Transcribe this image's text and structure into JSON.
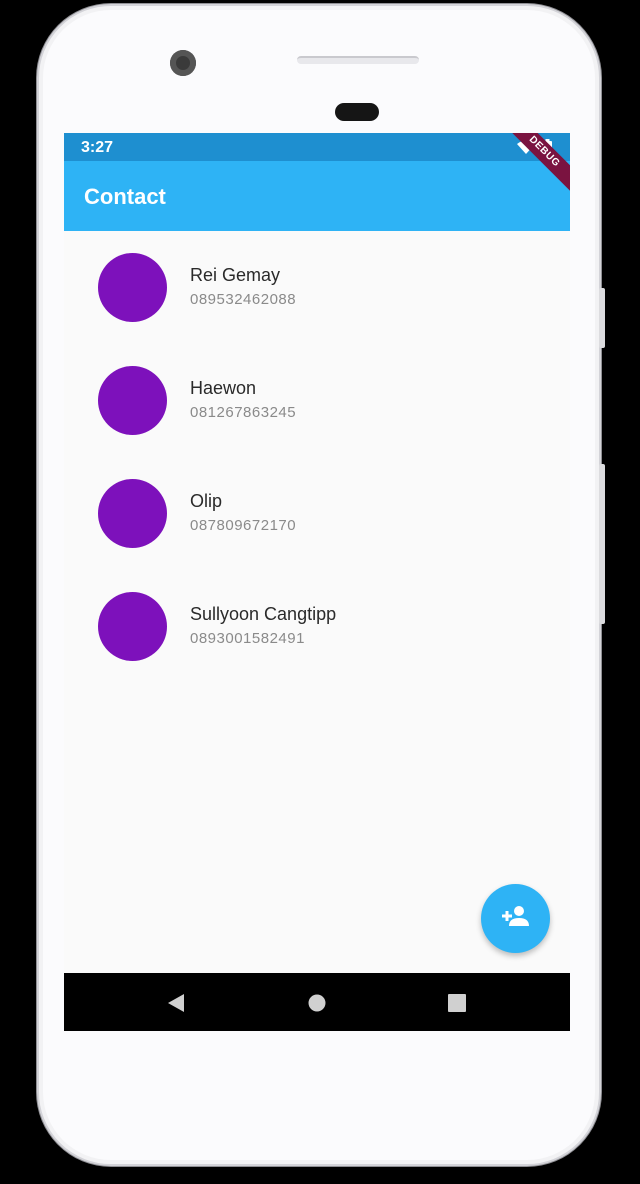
{
  "status_bar": {
    "time": "3:27",
    "icons": [
      "wifi-icon",
      "battery-icon"
    ]
  },
  "debug_banner": "DEBUG",
  "app_bar": {
    "title": "Contact"
  },
  "contacts": [
    {
      "name": "Rei Gemay",
      "phone": "089532462088"
    },
    {
      "name": "Haewon",
      "phone": "081267863245"
    },
    {
      "name": "Olip",
      "phone": "087809672170"
    },
    {
      "name": "Sullyoon Cangtipp",
      "phone": "0893001582491"
    }
  ],
  "fab": {
    "icon": "add-person-icon"
  },
  "nav_bar": {
    "icons": [
      "back-icon",
      "home-icon",
      "recents-icon"
    ]
  },
  "colors": {
    "app_bar": "#2eb3f5",
    "status_bar": "#1e8fd0",
    "avatar": "#7d11bb",
    "debug_banner": "#7a1340"
  }
}
